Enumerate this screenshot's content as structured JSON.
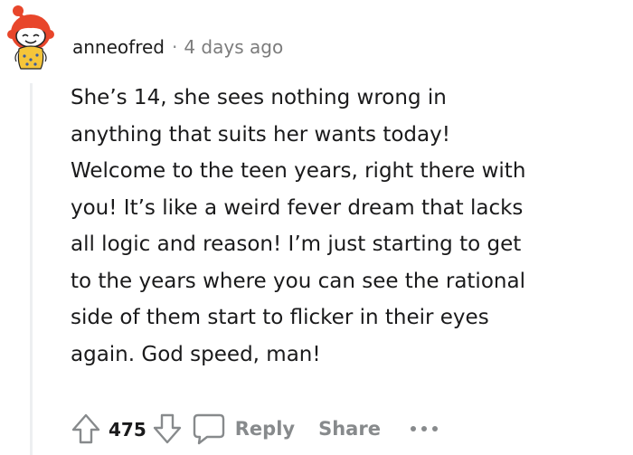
{
  "comment": {
    "author": "anneofred",
    "separator": "·",
    "timestamp": "4 days ago",
    "avatar_icon": "snoo-avatar-red-hair-yellow-shirt",
    "body_lines": [
      "She’s 14, she sees nothing wrong in",
      "anything that suits her wants today!",
      "Welcome to the teen years, right there with",
      "you! It’s like a weird fever dream that lacks",
      "all logic and reason! I’m just starting to get",
      "to the years where you can see the rational",
      "side of them start to flicker in their eyes",
      "again. God speed, man!"
    ]
  },
  "actions": {
    "upvote_icon": "upvote-arrow-icon",
    "vote_count": "475",
    "downvote_icon": "downvote-arrow-icon",
    "reply_icon": "speech-bubble-icon",
    "reply_label": "Reply",
    "share_label": "Share",
    "more_icon": "more-options-icon"
  },
  "colors": {
    "text_primary": "#1a1a1b",
    "text_muted": "#878a8c",
    "thread_line": "#edeff1",
    "avatar_hair": "#e8462b",
    "avatar_shirt": "#f5c53a"
  }
}
